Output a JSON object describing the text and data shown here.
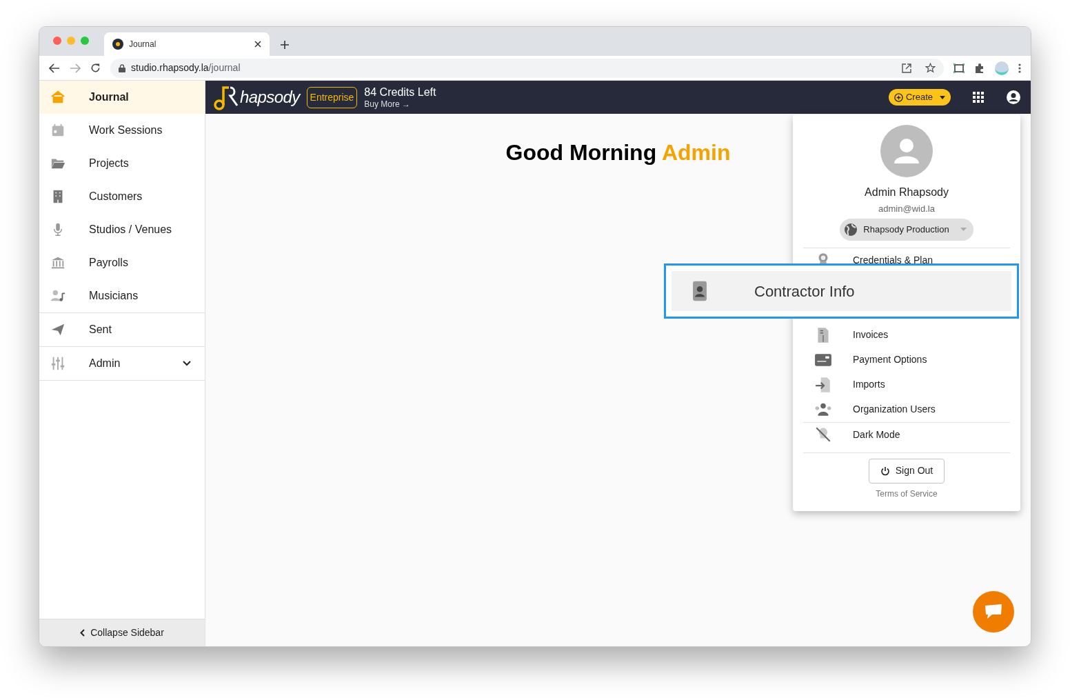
{
  "browser": {
    "tab": {
      "title": "Journal"
    },
    "url_host": "studio.rhapsody.la",
    "url_path": "/journal"
  },
  "sidebar": {
    "groups": [
      [
        {
          "label": "Journal",
          "selected": true
        },
        {
          "label": "Work Sessions",
          "selected": false
        },
        {
          "label": "Projects",
          "selected": false
        },
        {
          "label": "Customers",
          "selected": false
        },
        {
          "label": "Studios / Venues",
          "selected": false
        },
        {
          "label": "Payrolls",
          "selected": false
        },
        {
          "label": "Musicians",
          "selected": false
        }
      ],
      [
        {
          "label": "Sent",
          "selected": false
        }
      ],
      [
        {
          "label": "Admin",
          "selected": false,
          "expanded": false
        }
      ]
    ],
    "collapse": "Collapse Sidebar"
  },
  "header": {
    "logo": "hapsody",
    "plan": "Entreprise",
    "credits": "84 Credits Left",
    "buy_more": "Buy More →",
    "create": "Create"
  },
  "greeting": {
    "text": "Good Morning",
    "name": "Admin"
  },
  "account_menu": {
    "name": "Admin Rhapsody",
    "email": "admin@wid.la",
    "organization": "Rhapsody Production",
    "items": [
      {
        "label": "Credentials & Plan",
        "kind": "item"
      },
      {
        "label": "Invoices",
        "kind": "item"
      },
      {
        "label": "Payment Options",
        "kind": "item"
      },
      {
        "label": "Imports",
        "kind": "item"
      },
      {
        "label": "Organization Users",
        "kind": "item"
      },
      {
        "label": "Dark Mode",
        "kind": "divided"
      }
    ],
    "sign_out": "Sign Out",
    "terms": "Terms of Service"
  },
  "callout": {
    "label": "Contractor Info"
  }
}
